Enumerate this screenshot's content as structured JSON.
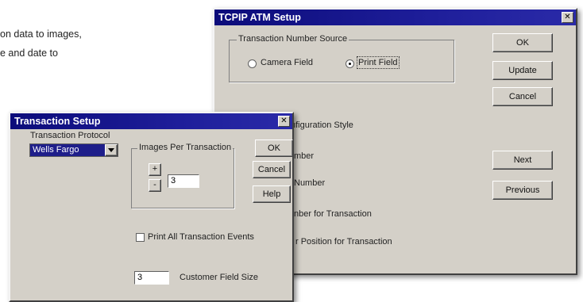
{
  "background": {
    "lines": [
      "on data to images,",
      "e and date to"
    ]
  },
  "tcpip_window": {
    "title": "TCPIP ATM Setup",
    "close_glyph": "✕",
    "group_label": "Transaction Number Source",
    "radios": [
      {
        "label": "Camera Field",
        "selected": false
      },
      {
        "label": "Print Field",
        "selected": true
      }
    ],
    "buttons": {
      "ok": "OK",
      "update": "Update",
      "cancel": "Cancel",
      "next": "Next",
      "previous": "Previous"
    },
    "labels": [
      "nfiguration Style",
      "mber",
      "Number",
      "nber for Transaction",
      "r Position for Transaction"
    ]
  },
  "transaction_window": {
    "title": "Transaction Setup",
    "close_glyph": "✕",
    "protocol_label": "Transaction Protocol",
    "protocol_value": "Wells Fargo",
    "images_group_label": "Images Per Transaction",
    "spin_up": "+",
    "spin_down": "-",
    "images_value": "3",
    "buttons": {
      "ok": "OK",
      "cancel": "Cancel",
      "help": "Help"
    },
    "print_all_label": "Print All Transaction Events",
    "print_all_checked": false,
    "customer_field_value": "3",
    "customer_field_label": "Customer Field Size"
  },
  "colors": {
    "titlebar": "#0c0c7a",
    "window_face": "#d4d0c8"
  }
}
